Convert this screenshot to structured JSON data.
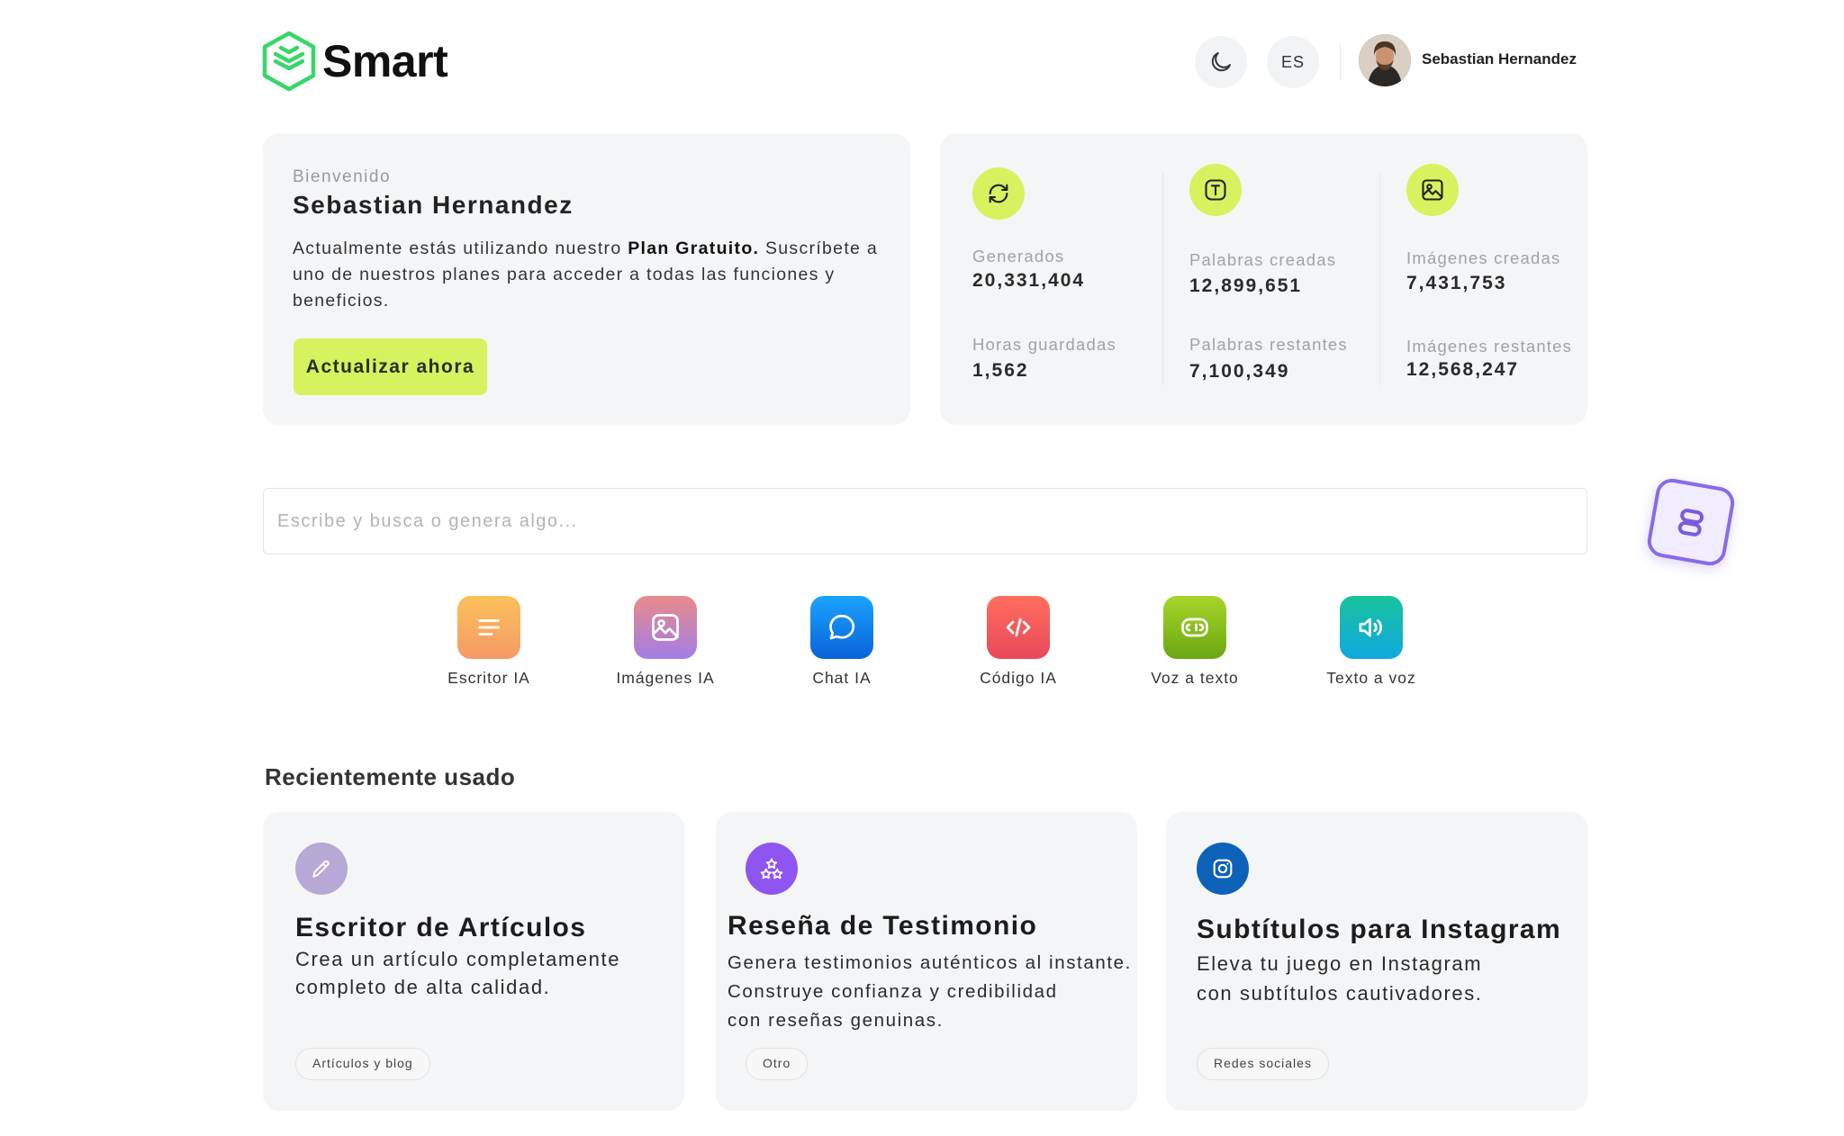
{
  "brand": {
    "name": "Smart",
    "accent": "#d6f25e",
    "logo_green": "#39d66b"
  },
  "header": {
    "lang": "ES",
    "user_name": "Sebastian Hernandez"
  },
  "welcome": {
    "greeting": "Bienvenido",
    "name": "Sebastian Hernandez",
    "desc_prefix": "Actualmente estás utilizando nuestro ",
    "plan": "Plan Gratuito.",
    "desc_suffix": " Suscríbete a uno de nuestros planes para acceder a todas las funciones y beneficios.",
    "upgrade_label": "Actualizar ahora"
  },
  "stats": [
    {
      "icon": "refresh-icon",
      "top_label": "Generados",
      "top_value": "20,331,404",
      "bottom_label": "Horas guardadas",
      "bottom_value": "1,562"
    },
    {
      "icon": "text-icon",
      "top_label": "Palabras creadas",
      "top_value": "12,899,651",
      "bottom_label": "Palabras restantes",
      "bottom_value": "7,100,349"
    },
    {
      "icon": "image-icon",
      "top_label": "Imágenes creadas",
      "top_value": "7,431,753",
      "bottom_label": "Imágenes restantes",
      "bottom_value": "12,568,247"
    }
  ],
  "search": {
    "placeholder": "Escribe y busca o genera algo..."
  },
  "tools": [
    {
      "label": "Escritor IA",
      "icon": "lines-icon"
    },
    {
      "label": "Imágenes IA",
      "icon": "image-icon"
    },
    {
      "label": "Chat IA",
      "icon": "chat-icon"
    },
    {
      "label": "Código IA",
      "icon": "code-icon"
    },
    {
      "label": "Voz a texto",
      "icon": "speech-to-text-icon"
    },
    {
      "label": "Texto a voz",
      "icon": "speaker-icon"
    }
  ],
  "recent": {
    "title": "Recientemente usado",
    "items": [
      {
        "title": "Escritor de Artículos",
        "desc_line1": "Crea un artículo completamente",
        "desc_line2": "completo de alta calidad.",
        "tag": "Artículos y blog",
        "icon": "pencil-icon"
      },
      {
        "title": "Reseña de Testimonio",
        "desc_line1": "Genera testimonios auténticos al instante.",
        "desc_line2": "Construye confianza y credibilidad",
        "desc_line3": "con reseñas genuinas.",
        "tag": "Otro",
        "icon": "stars-icon"
      },
      {
        "title": "Subtítulos para Instagram",
        "desc_line1": "Eleva tu juego en Instagram",
        "desc_line2": "con subtítulos cautivadores.",
        "tag": "Redes sociales",
        "icon": "instagram-icon"
      }
    ]
  }
}
